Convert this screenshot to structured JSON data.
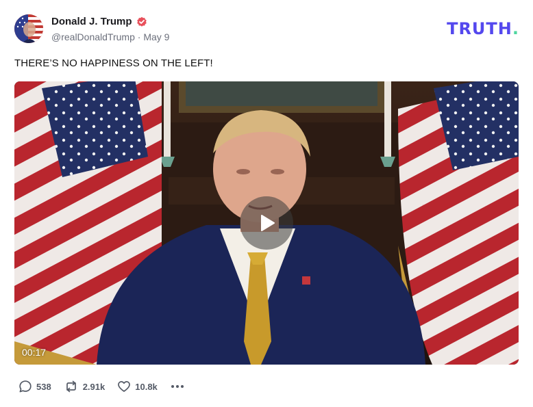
{
  "post": {
    "author": {
      "display_name": "Donald J. Trump",
      "handle": "@realDonaldTrump",
      "date": "May 9",
      "verified": true,
      "avatar_icon": "avatar-flag-portrait"
    },
    "text": "THERE’S NO HAPPINESS ON THE LEFT!",
    "media": {
      "type": "video",
      "duration": "00:17",
      "play_icon": "play-icon"
    },
    "stats": {
      "replies": "538",
      "reposts": "2.91k",
      "likes": "10.8k"
    }
  },
  "brand": {
    "wordmark": "TRUTH",
    "dot": ".",
    "colors": {
      "primary": "#5448ee",
      "accent": "#4fd6a0"
    }
  },
  "colors": {
    "verified": "#e8505b",
    "meta_text": "#6b6f7b"
  }
}
